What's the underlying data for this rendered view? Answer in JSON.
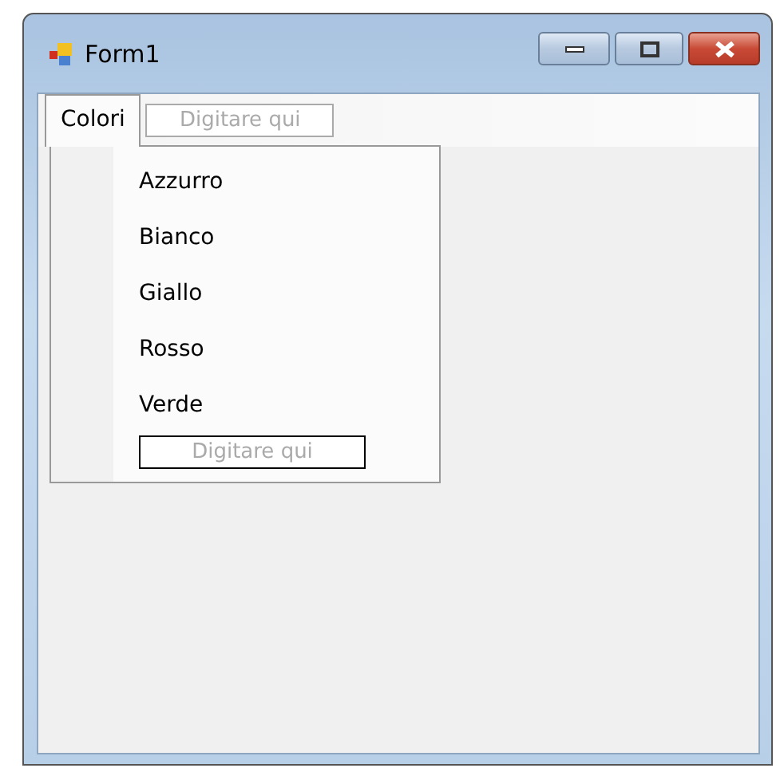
{
  "window": {
    "title": "Form1"
  },
  "menu_bar": {
    "items": [
      {
        "label": "Colori",
        "kind": "menu",
        "selected": true
      },
      {
        "label": "Digitare qui",
        "kind": "placeholder",
        "selected": false
      }
    ]
  },
  "dropdown": {
    "items": [
      {
        "label": "Azzurro",
        "kind": "item"
      },
      {
        "label": "Bianco",
        "kind": "item"
      },
      {
        "label": "Giallo",
        "kind": "item"
      },
      {
        "label": "Rosso",
        "kind": "item"
      },
      {
        "label": "Verde",
        "kind": "item"
      },
      {
        "label": "Digitare qui",
        "kind": "placeholder"
      }
    ]
  }
}
